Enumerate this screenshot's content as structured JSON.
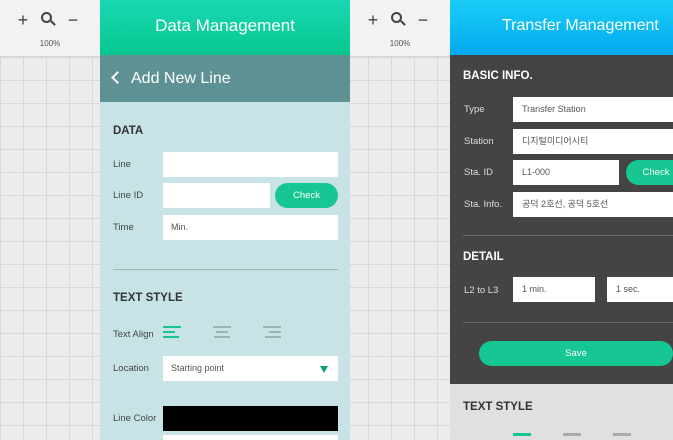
{
  "left_toolbar": {
    "zoom_in": "+",
    "zoom_out": "−",
    "zoom": "100%"
  },
  "right_toolbar": {
    "zoom_in": "+",
    "zoom_out": "−",
    "zoom": "100%"
  },
  "data_panel": {
    "header": "Data Management",
    "subheader": "Add New Line",
    "data_section": {
      "title": "DATA",
      "line_label": "Line",
      "line_value": "",
      "line_id_label": "Line ID",
      "line_id_value": "",
      "check_button": "Check",
      "time_label": "Time",
      "time_value": "Min."
    },
    "text_style_section": {
      "title": "TEXT STYLE",
      "text_align_label": "Text Align",
      "location_label": "Location",
      "location_value": "Starting point",
      "line_color_label": "Line Color",
      "line_color_value": "#000000"
    }
  },
  "transfer_panel": {
    "header": "Transfer Management",
    "basic_info": {
      "title": "BASIC INFO.",
      "type_label": "Type",
      "type_value": "Transfer Station",
      "station_label": "Station",
      "station_value": "디지털미디어시티",
      "sta_id_label": "Sta. ID",
      "sta_id_value": "L1-000",
      "check_button": "Check",
      "sta_info_label": "Sta. Info.",
      "sta_info_value": "공덕 2호선, 공덕 5호선"
    },
    "detail": {
      "title": "DETAIL",
      "l2_to_l3_label": "L2 to L3",
      "minutes_value": "1 min.",
      "seconds_value": "1 sec."
    },
    "save_button": "Save",
    "text_style_title": "TEXT STYLE"
  },
  "colors": {
    "data_header": "#05c78f",
    "transfer_header": "#03a9ef",
    "accent_green": "#16c794",
    "panel_bg": "#c7e3e6",
    "subheader_bg": "#5e9193",
    "dark_bg": "#444444"
  }
}
